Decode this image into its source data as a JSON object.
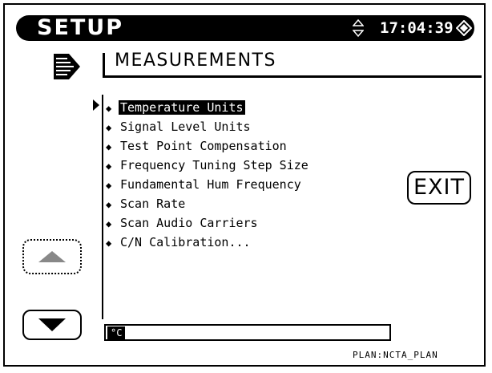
{
  "header": {
    "title": "SETUP",
    "clock": "17:04:39"
  },
  "page": {
    "heading": "MEASUREMENTS"
  },
  "menu": {
    "items": [
      {
        "label": "Temperature Units",
        "selected": true
      },
      {
        "label": "Signal Level Units",
        "selected": false
      },
      {
        "label": "Test Point Compensation",
        "selected": false
      },
      {
        "label": "Frequency Tuning Step Size",
        "selected": false
      },
      {
        "label": "Fundamental Hum Frequency",
        "selected": false
      },
      {
        "label": "Scan Rate",
        "selected": false
      },
      {
        "label": "Scan Audio Carriers",
        "selected": false
      },
      {
        "label": "C/N Calibration...",
        "selected": false
      }
    ]
  },
  "buttons": {
    "exit_label": "EXIT"
  },
  "value_field": {
    "value": "°C"
  },
  "footer": {
    "plan": "PLAN:NCTA_PLAN"
  },
  "icons": {
    "menu": "menu-arrow-icon",
    "updown": "up-down-arrows-icon",
    "status": "diamond-status-icon",
    "cursor": "cursor-arrow-icon",
    "scroll_up": "scroll-up-icon",
    "scroll_down": "scroll-down-icon"
  }
}
